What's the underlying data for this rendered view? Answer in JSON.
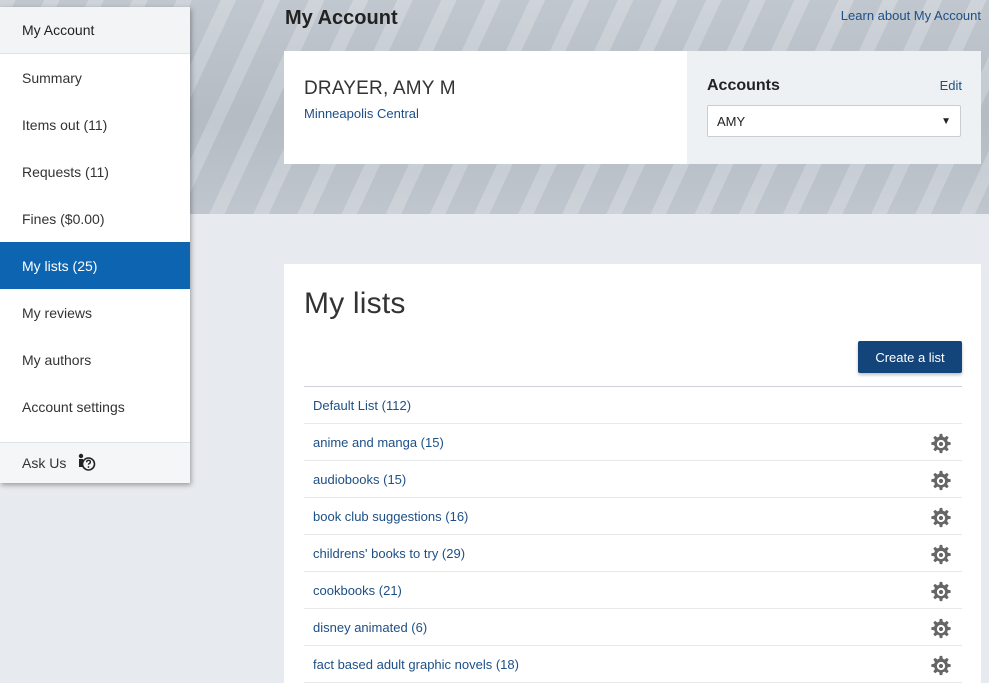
{
  "header": {
    "title": "My Account",
    "learn_link": "Learn about My Account"
  },
  "account_card": {
    "name": "DRAYER, AMY M",
    "branch": "Minneapolis Central",
    "accounts_label": "Accounts",
    "edit_label": "Edit",
    "selected_account": "AMY"
  },
  "sidebar": {
    "heading": "My Account",
    "items": [
      {
        "label": "Summary"
      },
      {
        "label": "Items out (11)"
      },
      {
        "label": "Requests (11)"
      },
      {
        "label": "Fines ($0.00)"
      },
      {
        "label": "My lists (25)"
      },
      {
        "label": "My reviews"
      },
      {
        "label": "My authors"
      },
      {
        "label": "Account settings"
      }
    ],
    "active_item": "My lists (25)",
    "footer": "Ask Us"
  },
  "lists_panel": {
    "title": "My lists",
    "create_label": "Create a list",
    "lists": [
      {
        "label": "Default List (112)"
      },
      {
        "label": "anime and manga (15)"
      },
      {
        "label": "audiobooks (15)"
      },
      {
        "label": "book club suggestions (16)"
      },
      {
        "label": "childrens' books to try (29)"
      },
      {
        "label": "cookbooks (21)"
      },
      {
        "label": "disney animated (6)"
      },
      {
        "label": "fact based adult graphic novels (18)"
      }
    ]
  },
  "colors": {
    "accent": "#0d64b0",
    "button": "#13457a",
    "link": "#1d4f86"
  }
}
